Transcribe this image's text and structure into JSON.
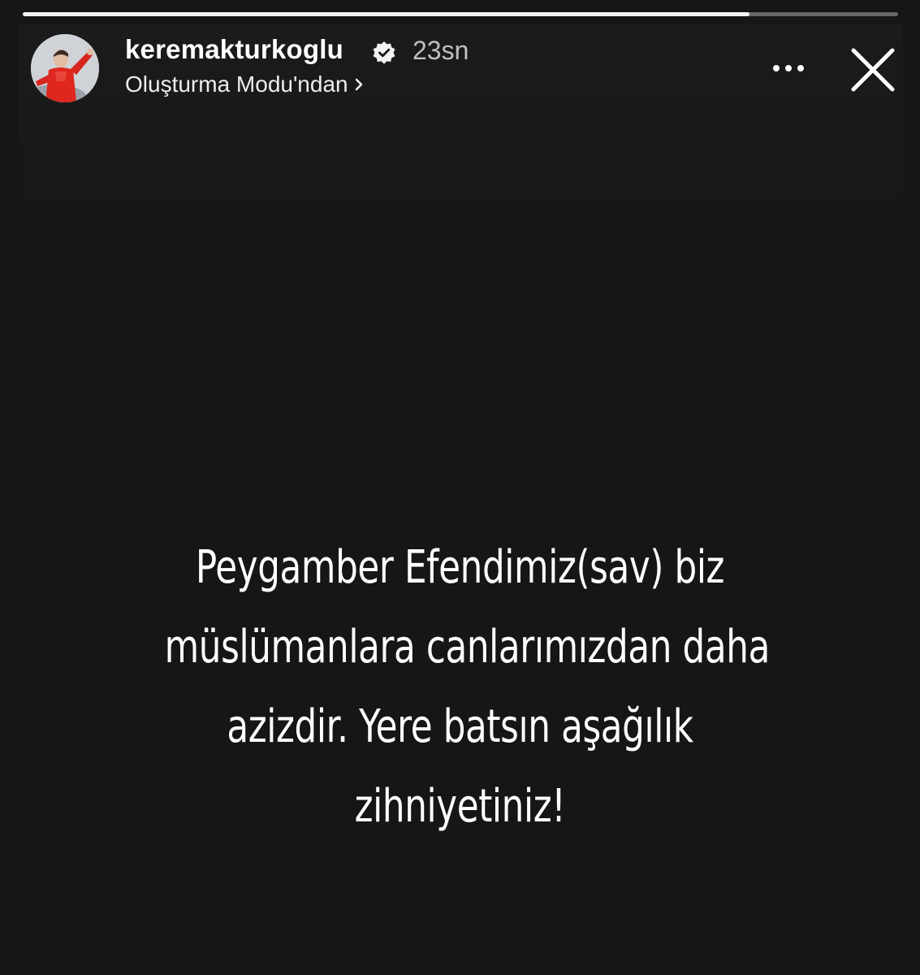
{
  "story": {
    "progress": 0.83,
    "background_color": "#161616"
  },
  "header": {
    "avatar_icon": "profile-photo-footballer-red-kit",
    "username": "keremakturkoglu",
    "verified_icon": "verified-badge-icon",
    "timestamp": "23sn",
    "subtitle": "Oluşturma Modu'ndan",
    "subtitle_icon": "chevron-right-icon",
    "more_icon": "more-horizontal-icon",
    "close_icon": "close-icon"
  },
  "content": {
    "lines": [
      "Peygamber Efendimiz(sav) biz",
      "müslümanlara canlarımızdan daha",
      "azizdir. Yere batsın aşağılık",
      "zihniyetiniz!"
    ]
  }
}
